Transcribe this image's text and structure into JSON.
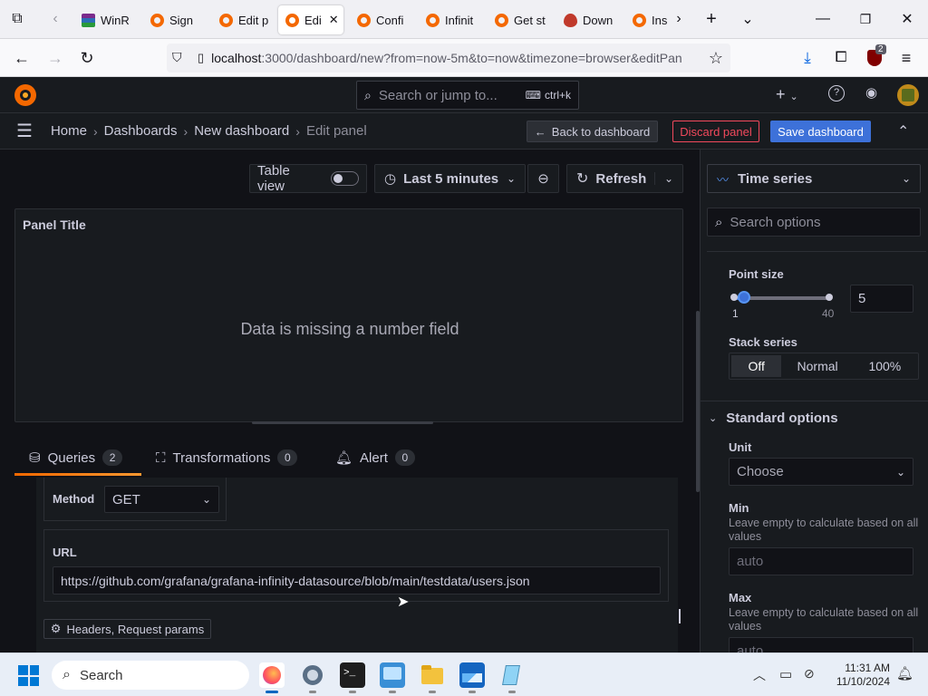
{
  "browser": {
    "tabs": [
      {
        "label": "WinR",
        "icon": "winrar-icon"
      },
      {
        "label": "Sign",
        "icon": "grafana-icon"
      },
      {
        "label": "Edit p",
        "icon": "grafana-icon"
      },
      {
        "label": "Edi",
        "icon": "grafana-icon",
        "active": true
      },
      {
        "label": "Confi",
        "icon": "grafana-icon"
      },
      {
        "label": "Infinit",
        "icon": "grafana-icon"
      },
      {
        "label": "Get st",
        "icon": "grafana-icon"
      },
      {
        "label": "Down",
        "icon": "drop-icon"
      },
      {
        "label": "Ins",
        "icon": "grafana-icon"
      }
    ],
    "url_host": "localhost",
    "url_rest": ":3000/dashboard/new?from=now-5m&to=now&timezone=browser&editPan",
    "extension_badge": "2"
  },
  "grafana": {
    "search_placeholder": "Search or jump to...",
    "search_shortcut": "ctrl+k",
    "breadcrumb": [
      "Home",
      "Dashboards",
      "New dashboard",
      "Edit panel"
    ],
    "back_label": "Back to dashboard",
    "discard_label": "Discard panel",
    "save_label": "Save dashboard",
    "colors": {
      "accent": "#3d71d9",
      "danger": "#f2495c",
      "orange": "#f46800",
      "bg": "#111217",
      "panel": "#181b1f"
    }
  },
  "toolbar": {
    "table_view": "Table view",
    "time_range": "Last 5 minutes",
    "refresh": "Refresh"
  },
  "panel": {
    "title": "Panel Title",
    "message": "Data is missing a number field"
  },
  "query_tabs": [
    {
      "label": "Queries",
      "count": "2"
    },
    {
      "label": "Transformations",
      "count": "0"
    },
    {
      "label": "Alert",
      "count": "0"
    }
  ],
  "query": {
    "method_label": "Method",
    "method_value": "GET",
    "url_label": "URL",
    "url_value": "https://github.com/grafana/grafana-infinity-datasource/blob/main/testdata/users.json",
    "headers_button": "Headers, Request params"
  },
  "options": {
    "visualization": "Time series",
    "search_placeholder": "Search options",
    "point_size_label": "Point size",
    "point_size_min": "1",
    "point_size_max": "40",
    "point_size_value": "5",
    "stack_label": "Stack series",
    "stack_options": [
      "Off",
      "Normal",
      "100%"
    ],
    "standard_options": "Standard options",
    "unit_label": "Unit",
    "unit_value": "Choose",
    "min_label": "Min",
    "min_desc": "Leave empty to calculate based on all values",
    "min_placeholder": "auto",
    "max_label": "Max",
    "max_desc": "Leave empty to calculate based on all values",
    "max_placeholder": "auto"
  },
  "taskbar": {
    "search_label": "Search",
    "time": "11:31 AM",
    "date": "11/10/2024"
  }
}
